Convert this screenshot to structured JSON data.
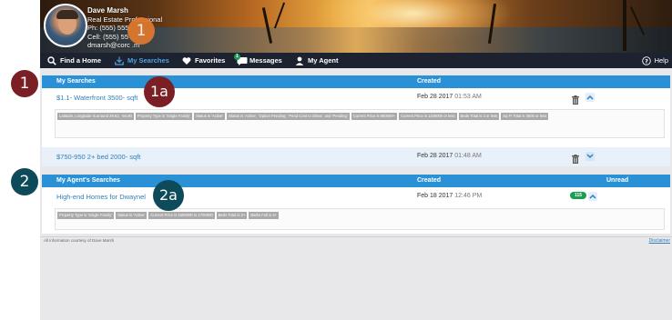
{
  "agent": {
    "name": "Dave Marsh",
    "title": "Real Estate Professional",
    "phone": "Ph: (555) 555-",
    "cell": "Cell: (555) 55",
    "email": "dmarsh@corc   .m"
  },
  "nav": {
    "items": [
      {
        "label": "Find a Home",
        "icon": "search-icon"
      },
      {
        "label": "My Searches",
        "icon": "download-icon"
      },
      {
        "label": "Favorites",
        "icon": "heart-icon"
      },
      {
        "label": "Messages",
        "icon": "chat-icon",
        "badge": "1"
      },
      {
        "label": "My Agent",
        "icon": "user-icon"
      }
    ],
    "help": "Help"
  },
  "my_searches": {
    "header": "My Searches",
    "created_header": "Created",
    "rows": [
      {
        "name": "$1.1- Waterfront 3500- sqft",
        "date": "Feb 28 2017",
        "time": "01:53 AM",
        "criteria": [
          "Latitude, Longitude is around 29.52, -94.90",
          "Property Type is 'Single Family'",
          "Status is 'Active'",
          "Status is 'Active', 'Option Pending', 'Pend Cont to Show', and 'Pending'",
          "Current Price is 850000+",
          "Current Price is 1100000 or less",
          "Beds Total is 3 or less",
          "Sq Ft Total is 3500 or less"
        ]
      },
      {
        "name": "$750-950 2+ bed 2000- sqft",
        "date": "Feb 28 2017",
        "time": "01:48 AM"
      }
    ]
  },
  "agent_searches": {
    "header": "My Agent's Searches",
    "created_header": "Created",
    "unread_header": "Unread",
    "rows": [
      {
        "name": "High-end Homes for Dwaynel",
        "date": "Feb 18 2017",
        "time": "12:46 PM",
        "unread": "115",
        "criteria": [
          "Property Type is 'Single Family'",
          "Status is 'Active'",
          "Current Price is 1500000 to 1700000",
          "Beds Total is 2+",
          "Baths Full is 3+"
        ]
      }
    ]
  },
  "footer": {
    "note": "All information courtesy of Dave Marsh",
    "disclaimer": "Disclaimer"
  },
  "callouts": {
    "c1_header": "1",
    "c1_left": "1",
    "c1a": "1a",
    "c2": "2",
    "c2a": "2a"
  },
  "colors": {
    "accent_blue": "#2a91d6",
    "nav_bg": "#1c2230",
    "active_nav": "#4da3dc",
    "link": "#2f7fb8",
    "unread_badge": "#1a9e54",
    "callout_orange": "#e1792e",
    "callout_maroon": "#7a1f24",
    "callout_teal": "#0d4a5a"
  }
}
